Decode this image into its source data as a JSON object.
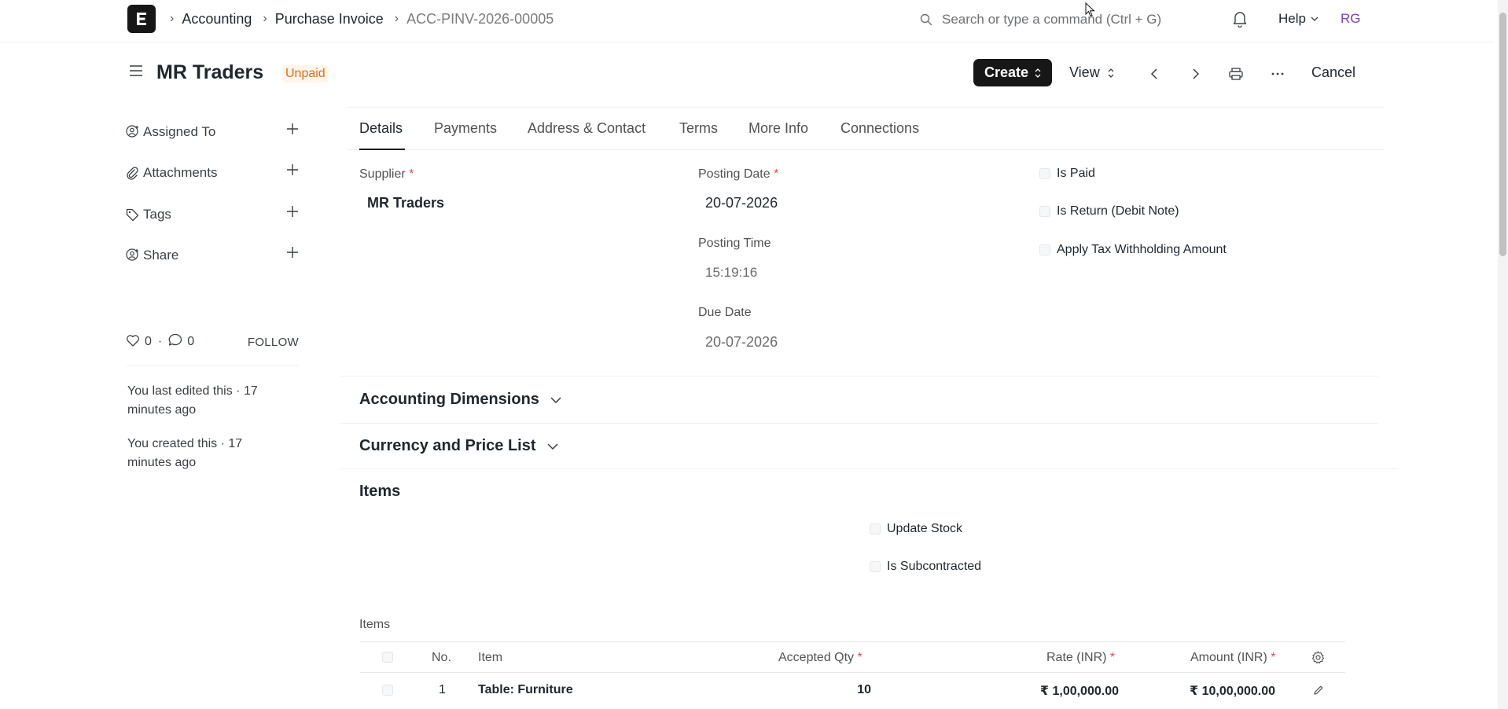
{
  "navbar": {
    "breadcrumbs": [
      "Accounting",
      "Purchase Invoice",
      "ACC-PINV-2026-00005"
    ],
    "search_placeholder": "Search or type a command (Ctrl + G)",
    "help_label": "Help",
    "avatar_initials": "RG"
  },
  "page": {
    "title": "MR Traders",
    "status": "Unpaid",
    "create_label": "Create",
    "view_label": "View",
    "cancel_label": "Cancel"
  },
  "sidebar": {
    "items": [
      {
        "label": "Assigned To",
        "icon": "user-plus-icon"
      },
      {
        "label": "Attachments",
        "icon": "paperclip-icon"
      },
      {
        "label": "Tags",
        "icon": "tag-icon"
      },
      {
        "label": "Share",
        "icon": "share-user-icon"
      }
    ],
    "likes_count": "0",
    "separator": "·",
    "comments_count": "0",
    "follow_label": "FOLLOW",
    "activity": [
      "You last edited this · 17 minutes ago",
      "You created this · 17 minutes ago"
    ]
  },
  "tabs": [
    "Details",
    "Payments",
    "Address & Contact",
    "Terms",
    "More Info",
    "Connections"
  ],
  "form": {
    "required_mark": "*",
    "supplier_label": "Supplier",
    "supplier_value": "MR Traders",
    "posting_date_label": "Posting Date",
    "posting_date_value": "20-07-2026",
    "posting_time_label": "Posting Time",
    "posting_time_value": "15:19:16",
    "due_date_label": "Due Date",
    "due_date_value": "20-07-2026",
    "is_paid_label": "Is Paid",
    "is_return_label": "Is Return (Debit Note)",
    "apply_tax_label": "Apply Tax Withholding Amount"
  },
  "sections": {
    "accounting_dimensions": "Accounting Dimensions",
    "currency_price_list": "Currency and Price List",
    "items": "Items",
    "update_stock_label": "Update Stock",
    "is_subcontracted_label": "Is Subcontracted",
    "items_table_label": "Items"
  },
  "items_table": {
    "columns": [
      "No.",
      "Item",
      "Accepted Qty",
      "Rate (INR)",
      "Amount (INR)"
    ],
    "rows": [
      {
        "no": "1",
        "item": "Table: Furniture",
        "qty": "10",
        "rate": "₹ 1,00,000.00",
        "amount": "₹ 10,00,000.00"
      }
    ]
  },
  "colors": {
    "status_unpaid": "#e86c13",
    "avatar": "#7e3fbf",
    "primary_button": "#171717",
    "required": "#e24c4c"
  }
}
